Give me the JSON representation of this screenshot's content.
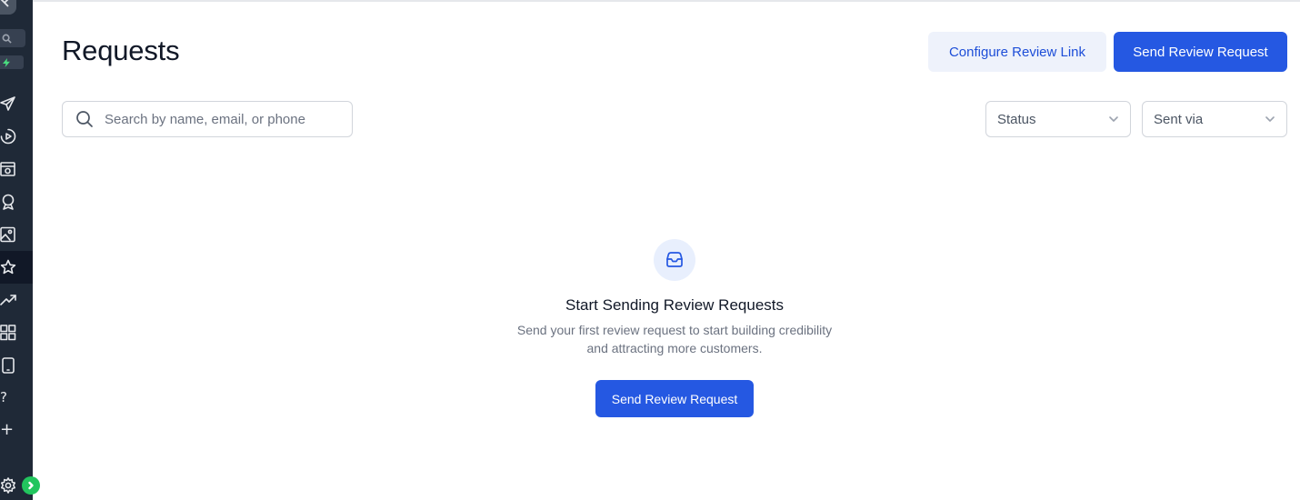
{
  "header": {
    "title": "Requests",
    "configure_label": "Configure Review Link",
    "send_label": "Send Review Request"
  },
  "filters": {
    "search_placeholder": "Search by name, email, or phone",
    "status_label": "Status",
    "sent_via_label": "Sent via"
  },
  "empty_state": {
    "icon": "inbox-icon",
    "title": "Start Sending Review Requests",
    "description_line1": "Send your first review request to start building credibility",
    "description_line2": "and attracting more customers.",
    "button_label": "Send Review Request"
  },
  "sidebar": {
    "items": [
      {
        "icon": "send-icon"
      },
      {
        "icon": "play-circle-icon"
      },
      {
        "icon": "browser-icon"
      },
      {
        "icon": "award-icon"
      },
      {
        "icon": "image-icon"
      },
      {
        "icon": "star-icon",
        "active": true
      },
      {
        "icon": "trending-up-icon"
      },
      {
        "icon": "grid-icon"
      },
      {
        "icon": "mobile-icon"
      },
      {
        "icon": "help-icon",
        "text": "?"
      },
      {
        "icon": "plus-icon",
        "text": "+"
      },
      {
        "icon": "gear-icon"
      }
    ]
  },
  "colors": {
    "primary": "#2558e2",
    "sidebar_bg": "#1f2937",
    "expand_green": "#22c55e"
  }
}
